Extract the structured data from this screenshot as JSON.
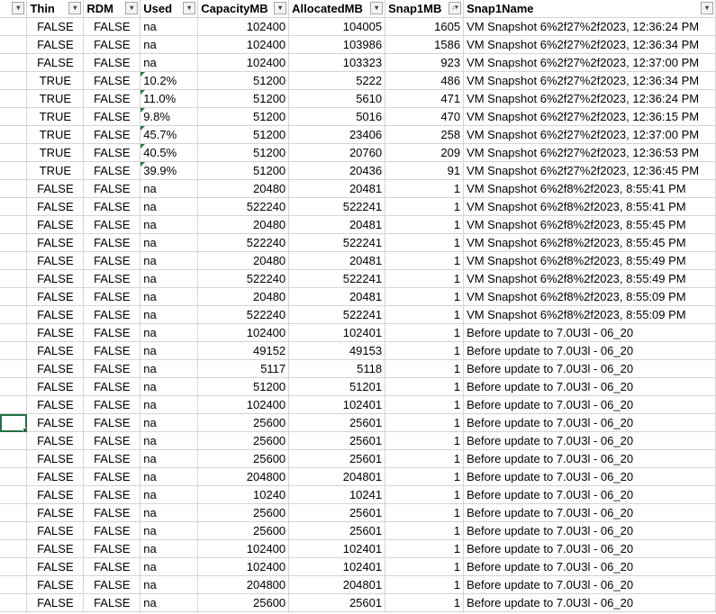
{
  "columns": [
    {
      "label": "",
      "class": "c0",
      "width": 30
    },
    {
      "label": "Thin",
      "class": "c-ctr",
      "width": 63
    },
    {
      "label": "RDM",
      "class": "c-ctr",
      "width": 63
    },
    {
      "label": "Used",
      "class": "c-txt",
      "width": 64
    },
    {
      "label": "CapacityMB",
      "class": "c-num",
      "width": 101
    },
    {
      "label": "AllocatedMB",
      "class": "c-num",
      "width": 107
    },
    {
      "label": "Snap1MB",
      "class": "c-num",
      "width": 87,
      "sorted": "desc"
    },
    {
      "label": "Snap1Name",
      "class": "c-txt",
      "width": 280
    }
  ],
  "rows": [
    [
      "",
      "FALSE",
      "FALSE",
      "na",
      "102400",
      "104005",
      "1605",
      "VM Snapshot 6%2f27%2f2023, 12:36:24 PM"
    ],
    [
      "",
      "FALSE",
      "FALSE",
      "na",
      "102400",
      "103986",
      "1586",
      "VM Snapshot 6%2f27%2f2023, 12:36:34 PM"
    ],
    [
      "",
      "FALSE",
      "FALSE",
      "na",
      "102400",
      "103323",
      "923",
      "VM Snapshot 6%2f27%2f2023, 12:37:00 PM"
    ],
    [
      "",
      "TRUE",
      "FALSE",
      "10.2%",
      "51200",
      "5222",
      "486",
      "VM Snapshot 6%2f27%2f2023, 12:36:34 PM"
    ],
    [
      "",
      "TRUE",
      "FALSE",
      "11.0%",
      "51200",
      "5610",
      "471",
      "VM Snapshot 6%2f27%2f2023, 12:36:24 PM"
    ],
    [
      "",
      "TRUE",
      "FALSE",
      "9.8%",
      "51200",
      "5016",
      "470",
      "VM Snapshot 6%2f27%2f2023, 12:36:15 PM"
    ],
    [
      "",
      "TRUE",
      "FALSE",
      "45.7%",
      "51200",
      "23406",
      "258",
      "VM Snapshot 6%2f27%2f2023, 12:37:00 PM"
    ],
    [
      "",
      "TRUE",
      "FALSE",
      "40.5%",
      "51200",
      "20760",
      "209",
      "VM Snapshot 6%2f27%2f2023, 12:36:53 PM"
    ],
    [
      "",
      "TRUE",
      "FALSE",
      "39.9%",
      "51200",
      "20436",
      "91",
      "VM Snapshot 6%2f27%2f2023, 12:36:45 PM"
    ],
    [
      "",
      "FALSE",
      "FALSE",
      "na",
      "20480",
      "20481",
      "1",
      "VM Snapshot 6%2f8%2f2023, 8:55:41 PM"
    ],
    [
      "",
      "FALSE",
      "FALSE",
      "na",
      "522240",
      "522241",
      "1",
      "VM Snapshot 6%2f8%2f2023, 8:55:41 PM"
    ],
    [
      "",
      "FALSE",
      "FALSE",
      "na",
      "20480",
      "20481",
      "1",
      "VM Snapshot 6%2f8%2f2023, 8:55:45 PM"
    ],
    [
      "",
      "FALSE",
      "FALSE",
      "na",
      "522240",
      "522241",
      "1",
      "VM Snapshot 6%2f8%2f2023, 8:55:45 PM"
    ],
    [
      "",
      "FALSE",
      "FALSE",
      "na",
      "20480",
      "20481",
      "1",
      "VM Snapshot 6%2f8%2f2023, 8:55:49 PM"
    ],
    [
      "",
      "FALSE",
      "FALSE",
      "na",
      "522240",
      "522241",
      "1",
      "VM Snapshot 6%2f8%2f2023, 8:55:49 PM"
    ],
    [
      "",
      "FALSE",
      "FALSE",
      "na",
      "20480",
      "20481",
      "1",
      "VM Snapshot 6%2f8%2f2023, 8:55:09 PM"
    ],
    [
      "",
      "FALSE",
      "FALSE",
      "na",
      "522240",
      "522241",
      "1",
      "VM Snapshot 6%2f8%2f2023, 8:55:09 PM"
    ],
    [
      "",
      "FALSE",
      "FALSE",
      "na",
      "102400",
      "102401",
      "1",
      "Before update to 7.0U3l - 06_20"
    ],
    [
      "",
      "FALSE",
      "FALSE",
      "na",
      "49152",
      "49153",
      "1",
      "Before update to 7.0U3l - 06_20"
    ],
    [
      "",
      "FALSE",
      "FALSE",
      "na",
      "5117",
      "5118",
      "1",
      "Before update to 7.0U3l - 06_20"
    ],
    [
      "",
      "FALSE",
      "FALSE",
      "na",
      "51200",
      "51201",
      "1",
      "Before update to 7.0U3l - 06_20"
    ],
    [
      "",
      "FALSE",
      "FALSE",
      "na",
      "102400",
      "102401",
      "1",
      "Before update to 7.0U3l - 06_20"
    ],
    [
      "",
      "FALSE",
      "FALSE",
      "na",
      "25600",
      "25601",
      "1",
      "Before update to 7.0U3l - 06_20"
    ],
    [
      "",
      "FALSE",
      "FALSE",
      "na",
      "25600",
      "25601",
      "1",
      "Before update to 7.0U3l - 06_20"
    ],
    [
      "",
      "FALSE",
      "FALSE",
      "na",
      "25600",
      "25601",
      "1",
      "Before update to 7.0U3l - 06_20"
    ],
    [
      "",
      "FALSE",
      "FALSE",
      "na",
      "204800",
      "204801",
      "1",
      "Before update to 7.0U3l - 06_20"
    ],
    [
      "",
      "FALSE",
      "FALSE",
      "na",
      "10240",
      "10241",
      "1",
      "Before update to 7.0U3l - 06_20"
    ],
    [
      "",
      "FALSE",
      "FALSE",
      "na",
      "25600",
      "25601",
      "1",
      "Before update to 7.0U3l - 06_20"
    ],
    [
      "",
      "FALSE",
      "FALSE",
      "na",
      "25600",
      "25601",
      "1",
      "Before update to 7.0U3l - 06_20"
    ],
    [
      "",
      "FALSE",
      "FALSE",
      "na",
      "102400",
      "102401",
      "1",
      "Before update to 7.0U3l - 06_20"
    ],
    [
      "",
      "FALSE",
      "FALSE",
      "na",
      "102400",
      "102401",
      "1",
      "Before update to 7.0U3l - 06_20"
    ],
    [
      "",
      "FALSE",
      "FALSE",
      "na",
      "204800",
      "204801",
      "1",
      "Before update to 7.0U3l - 06_20"
    ],
    [
      "",
      "FALSE",
      "FALSE",
      "na",
      "25600",
      "25601",
      "1",
      "Before update to 7.0U3l - 06_20"
    ]
  ],
  "selected_row": 22,
  "icons": {
    "filter": "filter-dropdown-icon",
    "sort_desc": "sort-descending-filter-icon"
  },
  "colors": {
    "gridline": "#d4d4d4",
    "selection": "#217346",
    "error_indicator": "#1e7b34"
  }
}
